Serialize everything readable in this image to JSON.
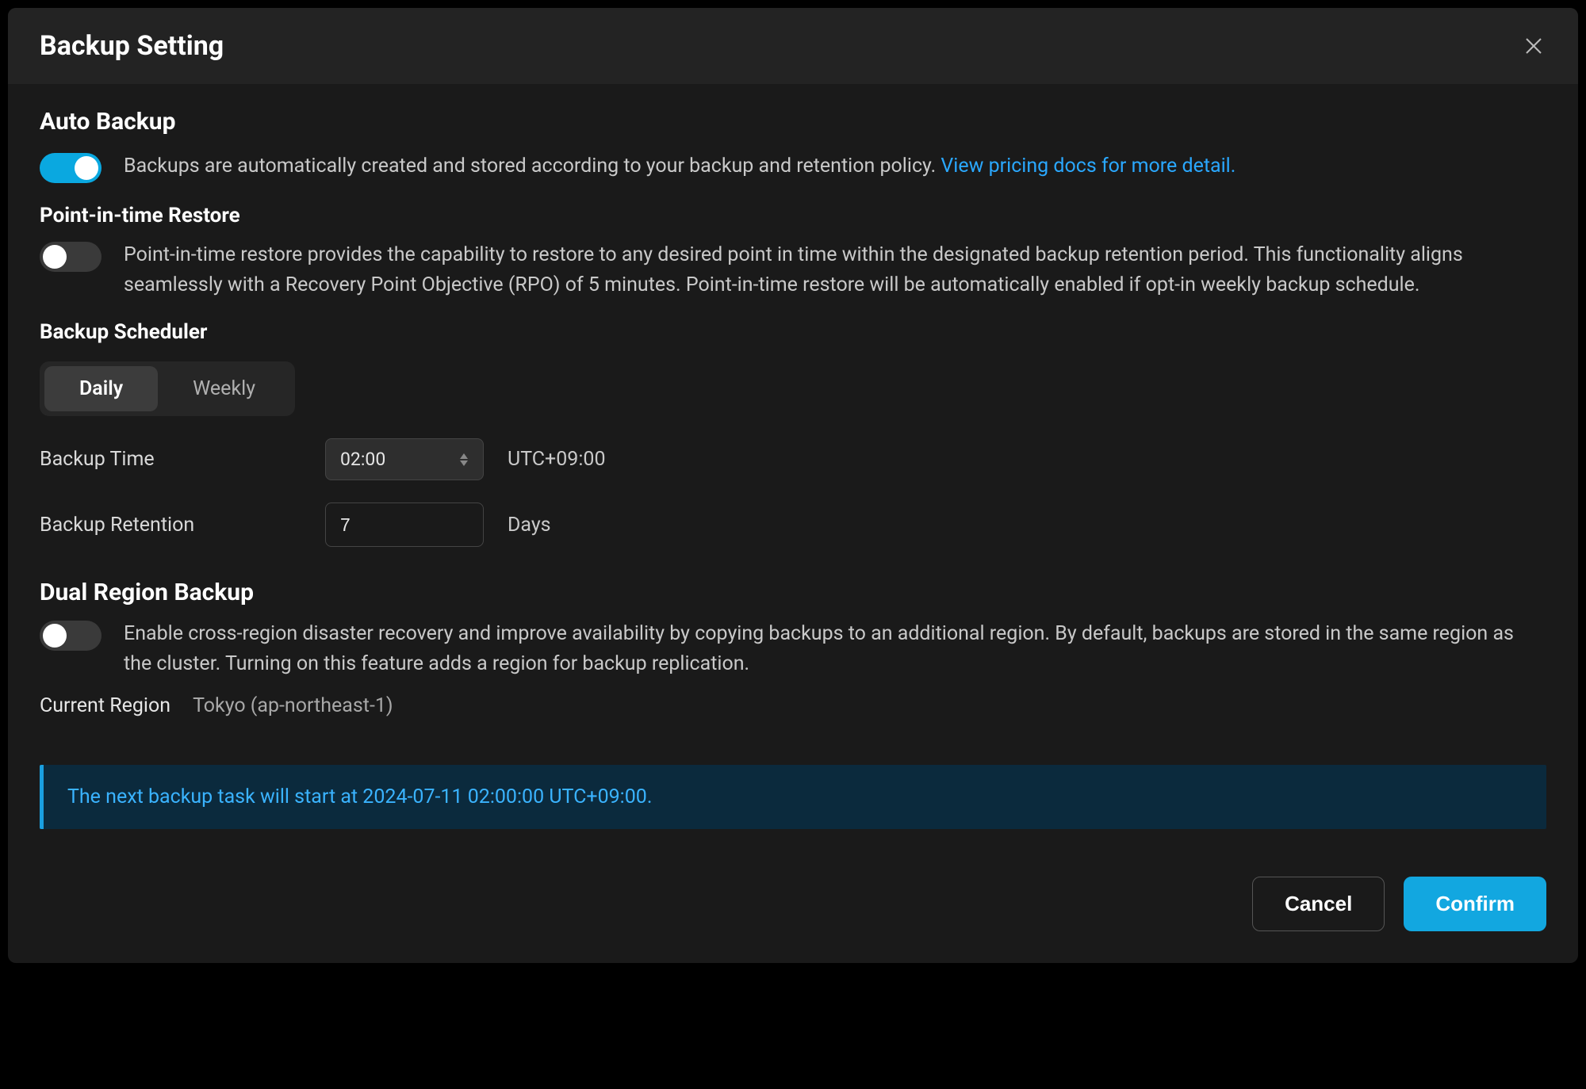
{
  "modal": {
    "title": "Backup Setting"
  },
  "autoBackup": {
    "title": "Auto Backup",
    "desc": "Backups are automatically created and stored according to your backup and retention policy. ",
    "link": "View pricing docs for more detail.",
    "enabled": true
  },
  "pitr": {
    "title": "Point-in-time Restore",
    "desc": "Point-in-time restore provides the capability to restore to any desired point in time within the designated backup retention period. This functionality aligns seamlessly with a Recovery Point Objective (RPO) of 5 minutes. Point-in-time restore will be automatically enabled if opt-in weekly backup schedule.",
    "enabled": false
  },
  "scheduler": {
    "title": "Backup Scheduler",
    "tabs": {
      "daily": "Daily",
      "weekly": "Weekly",
      "active": "daily"
    },
    "backupTimeLabel": "Backup Time",
    "backupTimeValue": "02:00",
    "timezone": "UTC+09:00",
    "retentionLabel": "Backup Retention",
    "retentionValue": "7",
    "retentionUnit": "Days"
  },
  "dualRegion": {
    "title": "Dual Region Backup",
    "desc": "Enable cross-region disaster recovery and improve availability by copying backups to an additional region. By default, backups are stored in the same region as the cluster. Turning on this feature adds a region for backup replication.",
    "enabled": false,
    "currentRegionLabel": "Current Region",
    "currentRegionValue": "Tokyo (ap-northeast-1)"
  },
  "banner": {
    "text": "The next backup task will start at 2024-07-11 02:00:00 UTC+09:00."
  },
  "footer": {
    "cancel": "Cancel",
    "confirm": "Confirm"
  }
}
